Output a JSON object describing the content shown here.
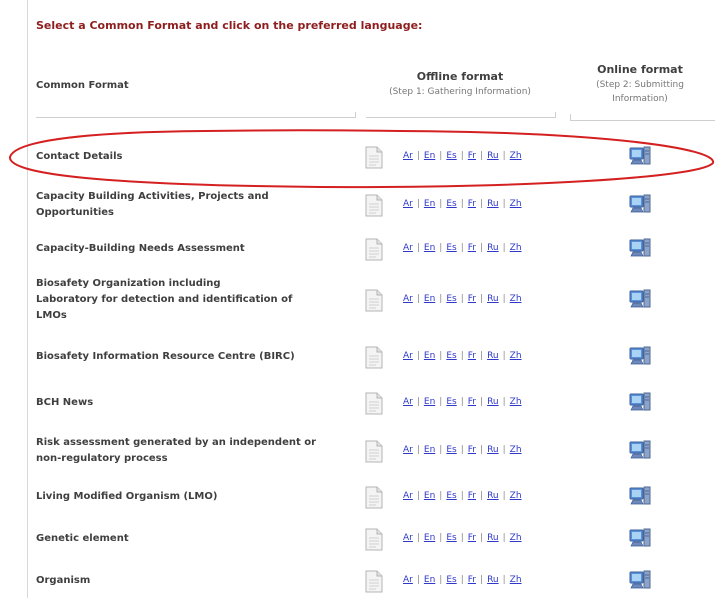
{
  "intro_text": "Select a Common Format and click on the preferred language:",
  "headers": {
    "common_format": "Common Format",
    "offline_title": "Offline format",
    "offline_sub": "(Step 1: Gathering Information)",
    "online_title": "Online format",
    "online_sub_1": "(Step 2: Submitting",
    "online_sub_2": "Information)"
  },
  "languages": [
    "Ar",
    "En",
    "Es",
    "Fr",
    "Ru",
    "Zh"
  ],
  "separator": "|",
  "rows": [
    {
      "lines": [
        "Contact Details"
      ]
    },
    {
      "lines": [
        "Capacity Building Activities, Projects and",
        "Opportunities"
      ]
    },
    {
      "lines": [
        "Capacity-Building Needs Assessment"
      ]
    },
    {
      "lines": [
        "Biosafety Organization including",
        "Laboratory for detection and identification of",
        "LMOs"
      ]
    },
    {
      "lines": [
        "Biosafety Information Resource Centre (BIRC)"
      ]
    },
    {
      "lines": [
        "BCH News"
      ]
    },
    {
      "lines": [
        "Risk assessment generated by an independent or",
        "non-regulatory process"
      ]
    },
    {
      "lines": [
        "Living Modified Organism (LMO)"
      ]
    },
    {
      "lines": [
        "Genetic element"
      ]
    },
    {
      "lines": [
        "Organism"
      ]
    }
  ],
  "icons": {
    "offline": "document-icon",
    "online": "computer-icon"
  },
  "colors": {
    "intro": "#8e1d1d",
    "link": "#2f39c7",
    "highlight_oval": "#d42020"
  }
}
